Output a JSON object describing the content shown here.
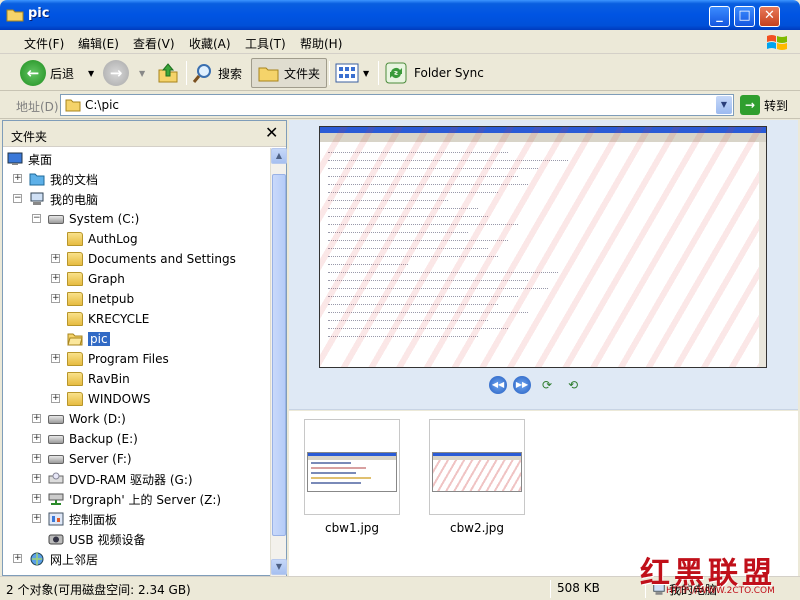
{
  "window": {
    "title": "pic"
  },
  "menu": [
    "文件(F)",
    "编辑(E)",
    "查看(V)",
    "收藏(A)",
    "工具(T)",
    "帮助(H)"
  ],
  "toolbar": {
    "back": "后退",
    "search": "搜索",
    "folders": "文件夹",
    "folder_sync": "Folder Sync"
  },
  "address": {
    "label": "地址(D)",
    "path": "C:\\pic",
    "go": "转到"
  },
  "folder_pane": {
    "title": "文件夹",
    "tree": [
      {
        "label": "桌面"
      },
      {
        "label": "我的文档"
      },
      {
        "label": "我的电脑"
      },
      {
        "label": "System (C:)"
      },
      {
        "label": "AuthLog"
      },
      {
        "label": "Documents and Settings"
      },
      {
        "label": "Graph"
      },
      {
        "label": "Inetpub"
      },
      {
        "label": "KRECYCLE"
      },
      {
        "label": "pic"
      },
      {
        "label": "Program Files"
      },
      {
        "label": "RavBin"
      },
      {
        "label": "WINDOWS"
      },
      {
        "label": "Work (D:)"
      },
      {
        "label": "Backup (E:)"
      },
      {
        "label": "Server (F:)"
      },
      {
        "label": "DVD-RAM 驱动器 (G:)"
      },
      {
        "label": "'Drgraph' 上的 Server (Z:)"
      },
      {
        "label": "控制面板"
      },
      {
        "label": "USB 视频设备"
      },
      {
        "label": "网上邻居"
      }
    ]
  },
  "files": [
    {
      "name": "cbw1.jpg"
    },
    {
      "name": "cbw2.jpg"
    }
  ],
  "status": {
    "objects": "2 个对象(可用磁盘空间: 2.34 GB)",
    "size": "508 KB",
    "location": "我的电脑"
  },
  "watermark": {
    "text": "红黑联盟",
    "url": "HTTP://WWW.2CTO.COM"
  },
  "colors": {
    "title_bar": "#0054e3",
    "selection": "#316ac5",
    "preview_bg": "#dfe9f5"
  }
}
